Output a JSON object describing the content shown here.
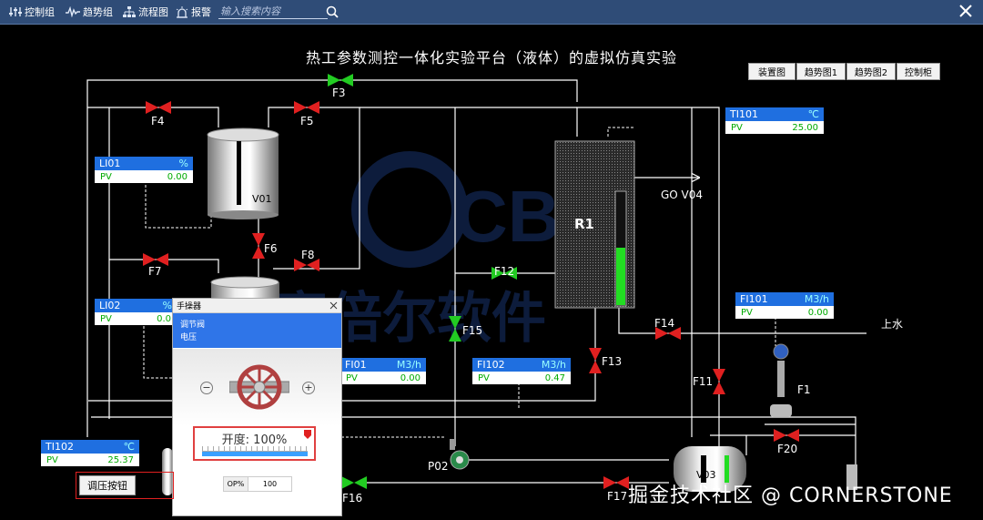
{
  "toolbar": {
    "items": [
      "控制组",
      "趋势组",
      "流程图",
      "报警"
    ],
    "search_placeholder": "输入搜索内容"
  },
  "title": "热工参数测控一体化实验平台（液体）的虚拟仿真实验",
  "nav_buttons": [
    "装置图",
    "趋势图1",
    "趋势图2",
    "控制柜"
  ],
  "tags": {
    "ti101": {
      "name": "TI101",
      "unit": "℃",
      "pv_label": "PV",
      "pv": "25.00"
    },
    "li01": {
      "name": "LI01",
      "unit": "%",
      "pv_label": "PV",
      "pv": "0.00"
    },
    "li02": {
      "name": "LI02",
      "unit": "%",
      "pv_label": "PV",
      "pv": "0.0"
    },
    "fi01": {
      "name": "FI01",
      "unit": "M3/h",
      "pv_label": "PV",
      "pv": "0.00"
    },
    "fi102": {
      "name": "FI102",
      "unit": "M3/h",
      "pv_label": "PV",
      "pv": "0.47"
    },
    "fi101": {
      "name": "FI101",
      "unit": "M3/h",
      "pv_label": "PV",
      "pv": "0.00"
    },
    "ti102": {
      "name": "TI102",
      "unit": "℃",
      "pv_label": "PV",
      "pv": "25.37"
    }
  },
  "labels": {
    "F1": "F1",
    "F3": "F3",
    "F4": "F4",
    "F5": "F5",
    "F6": "F6",
    "F7": "F7",
    "F8": "F8",
    "F11": "F11",
    "F12": "F12",
    "F13": "F13",
    "F14": "F14",
    "F15": "F15",
    "F16": "F16",
    "F17": "F17",
    "F20": "F20",
    "V01": "V01",
    "V03": "V03",
    "R1": "R1",
    "P02": "P02",
    "go_v04": "GO V04",
    "shangshui": "上水"
  },
  "watermark_brand": "CBR",
  "watermark_cn": "赛倍尔软件",
  "watermark": "掘金技术社区 @ CORNERSTONE",
  "popup": {
    "title": "手操器",
    "line1": "调节阀",
    "line2": "电压",
    "kaidu": "开度: 100%",
    "kaidu_value": 1.0,
    "op_label": "OP%",
    "op_value": "100"
  },
  "tiaoya_button": "调压按钮",
  "colors": {
    "valve_open": "#22cc22",
    "valve_closed": "#e02020",
    "tag_header": "#1f6fe0",
    "level_fill": "#22dd22"
  }
}
